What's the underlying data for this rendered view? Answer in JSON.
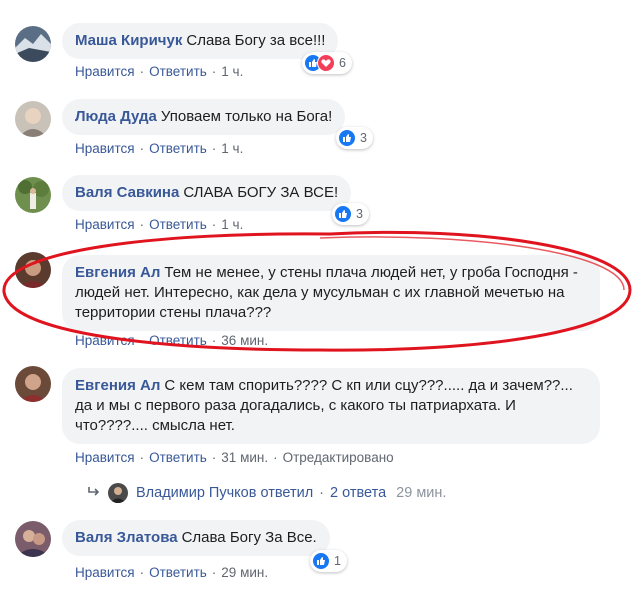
{
  "comments": [
    {
      "author": "Маша Киричук",
      "text": "Слава Богу за все!!!",
      "like": "Нравится",
      "reply": "Ответить",
      "time": "1 ч.",
      "reactions": "6"
    },
    {
      "author": "Люда Дуда",
      "text": "Уповаем только на Бога!",
      "like": "Нравится",
      "reply": "Ответить",
      "time": "1 ч.",
      "reactions": "3"
    },
    {
      "author": "Валя Савкина",
      "text": "СЛАВА БОГУ ЗА ВСЕ!",
      "like": "Нравится",
      "reply": "Ответить",
      "time": "1 ч.",
      "reactions": "3"
    },
    {
      "author": "Евгения Ал",
      "text": "Тем не менее, у стены плача людей нет, у гроба Господня - людей нет. Интересно, как дела у мусульман с их главной мечетью на территории стены плача???",
      "like": "Нравится",
      "reply": "Ответить",
      "time": "36 мин."
    },
    {
      "author": "Евгения Ал",
      "text": "С кем там спорить???? С кп или сцу???..... да и зачем??... да и мы с первого раза догадались, с какого ты патриархата. И что????.... смысла нет.",
      "like": "Нравится",
      "reply": "Ответить",
      "time": "31 мин.",
      "edited": "Отредактировано"
    },
    {
      "author": "Валя Златова",
      "text": "Слава Богу За Все.",
      "like": "Нравится",
      "reply": "Ответить",
      "time": "29 мин.",
      "reactions": "1"
    }
  ],
  "replies_link": {
    "author_action": "Владимир Пучков ответил",
    "count": "2 ответа",
    "time": "29 мин."
  },
  "colors": {
    "link": "#385898",
    "bubble": "#f2f3f5",
    "like": "#1877f2",
    "love": "#f33e58",
    "highlight": "#e0141e"
  }
}
